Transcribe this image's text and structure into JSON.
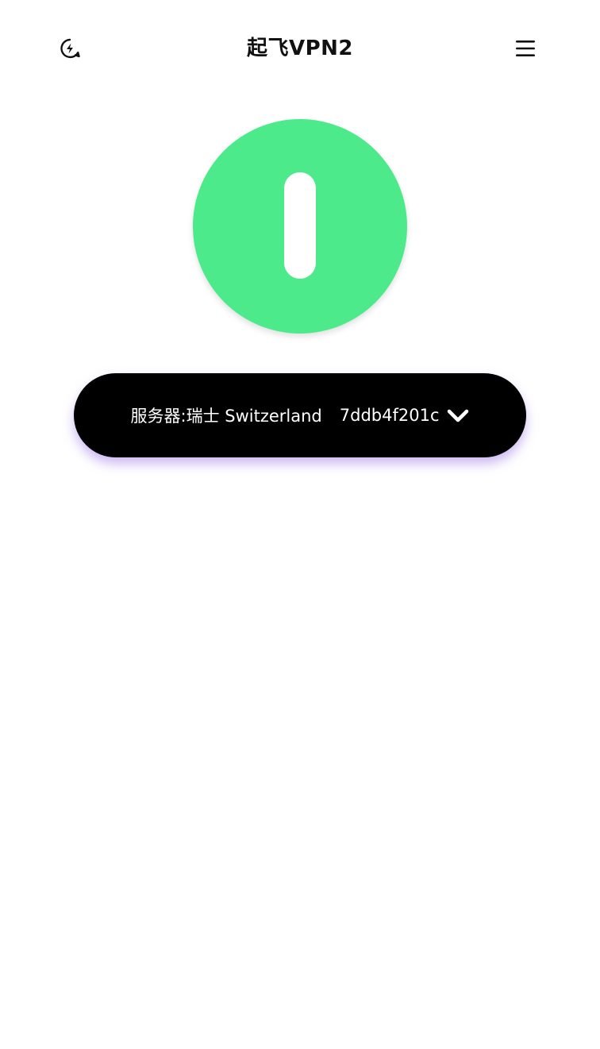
{
  "header": {
    "title": "起飞VPN2",
    "left_icon": "lightning-bolt-circle-icon",
    "right_icon": "hamburger-menu-icon"
  },
  "power": {
    "accent_color": "#4cea8b",
    "icon": "power-bar-icon"
  },
  "server": {
    "label": "服务器:瑞士 Switzerland",
    "node_id": "7ddb4f201c",
    "dropdown_icon": "chevron-down-icon",
    "background_color": "#000000",
    "glow_color": "#a480e8"
  }
}
